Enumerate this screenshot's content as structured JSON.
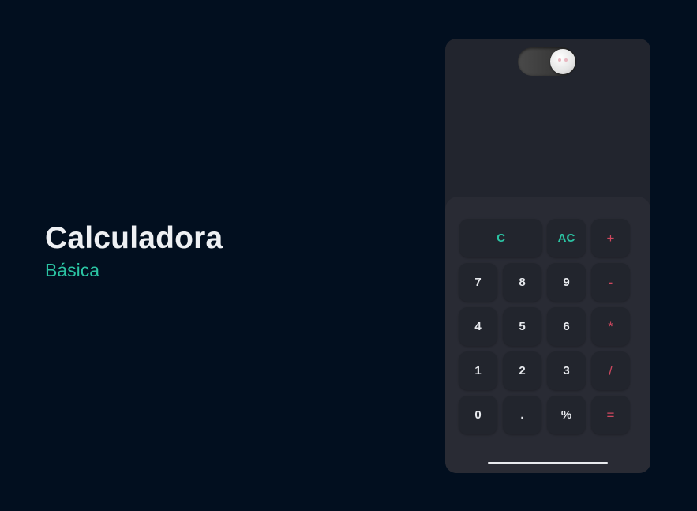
{
  "hero": {
    "title": "Calculadora",
    "subtitle": "Básica"
  },
  "calculator": {
    "theme_toggle": {
      "state": "dark",
      "icon": "moon-face-icon"
    },
    "display": {
      "value": ""
    },
    "keys": {
      "clear": "C",
      "all_clear": "AC",
      "plus": "+",
      "seven": "7",
      "eight": "8",
      "nine": "9",
      "minus": "-",
      "four": "4",
      "five": "5",
      "six": "6",
      "multiply": "*",
      "one": "1",
      "two": "2",
      "three": "3",
      "divide": "/",
      "zero": "0",
      "decimal": ".",
      "percent": "%",
      "equals": "="
    }
  },
  "colors": {
    "background": "#020f1f",
    "accent_teal": "#2bc4a3",
    "accent_red": "#d0485f",
    "panel": "#22252e"
  }
}
